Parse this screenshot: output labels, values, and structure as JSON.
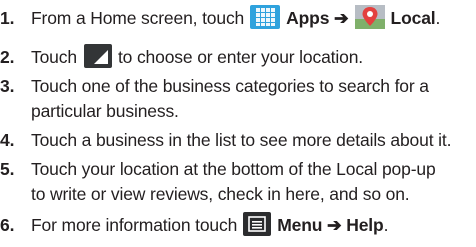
{
  "steps": [
    {
      "number": "1.",
      "text_before": "From a Home screen, touch",
      "apps_label": "Apps",
      "arrow": "➔",
      "local_label": "Local",
      "end": "."
    },
    {
      "number": "2.",
      "text_before": "Touch",
      "text_after": "to choose or enter your location."
    },
    {
      "number": "3.",
      "line1": "Touch one of the business categories to search for a",
      "line2": "particular business."
    },
    {
      "number": "4.",
      "line1": "Touch a business in the list to see more details about it."
    },
    {
      "number": "5.",
      "line1": "Touch your location at the bottom of the Local pop-up",
      "line2": "to write or view reviews, check in here, and so on."
    },
    {
      "number": "6.",
      "text_before": "For more information touch",
      "menu_label": "Menu",
      "arrow": "➔",
      "help_label": "Help",
      "end": "."
    }
  ],
  "icons": {
    "apps": "apps-grid-icon",
    "local": "local-map-pin-icon",
    "location": "location-corner-icon",
    "menu": "menu-icon"
  },
  "colors": {
    "text": "#231f20",
    "apps_icon": "#2fa2dd",
    "local_pin": "#e3413f",
    "dark_icon": "#333537"
  }
}
